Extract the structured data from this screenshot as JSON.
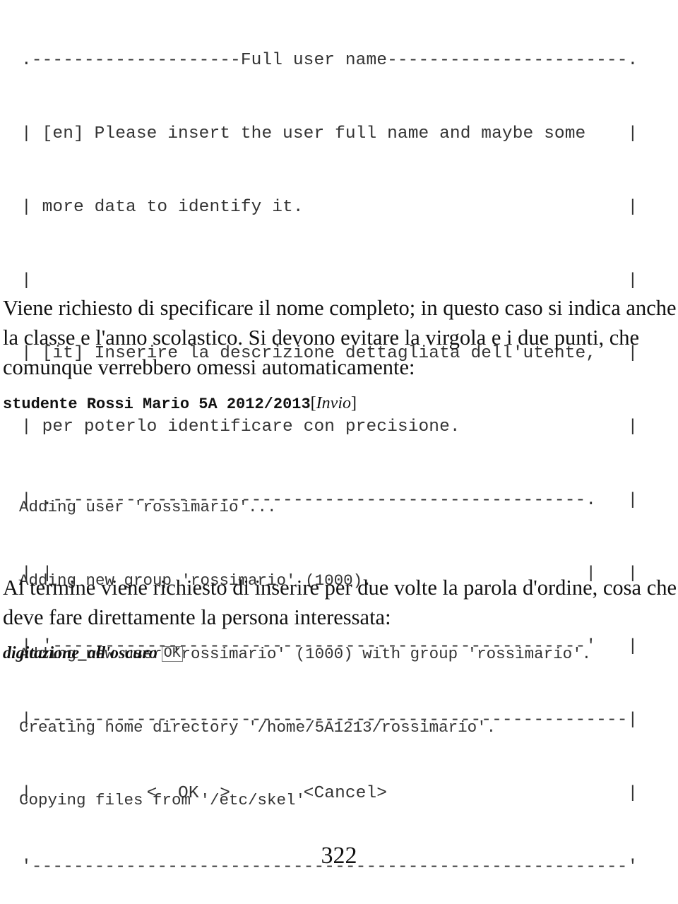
{
  "dialog": {
    "lines": [
      ".--------------------Full user name-----------------------.",
      "| [en] Please insert the user full name and maybe some    |",
      "| more data to identify it.                               |",
      "|                                                         |",
      "| [it] Inserire la descrizione dettagliata dell'utente,   |",
      "| per poterlo identificare con precisione.                |",
      "| .---------------------------------------------------.   |",
      "| |                                                   |   |",
      "| '---------------------------------------------------'   |",
      "|---------------------------------------------------------|",
      "|           <  OK  >       <Cancel>                       |",
      "'---------------------------------------------------------'"
    ],
    "title": "Full user name",
    "ok_button": "<  OK  >",
    "cancel_button": "<Cancel>"
  },
  "paragraph1": "Viene richiesto di specificare il nome completo; in questo caso si indica anche la classe e l'anno scolastico. Si devono evitare la virgola e i due punti, che comunque verrebbero omessi automaticamente:",
  "command": {
    "text": "studente Rossi Mario 5A 2012/2013",
    "key_open": "[",
    "key": "Invio",
    "key_close": "]"
  },
  "output_lines": [
    "Adding user 'rossimario'...",
    "Adding new group 'rossimario' (1000).",
    "Adding new user 'rossimario' (1000) with group 'rossimario'.",
    "Creating home directory '/home/5A1213/rossimario'.",
    "Copying files from '/etc/skel'"
  ],
  "paragraph2": "Al termine viene richiesto di inserire per due volte la parola d'ordine, cosa che deve fare direttamente la persona interessata:",
  "password_prompt": {
    "text": "digitazione_all'oscuro",
    "key": "OK"
  },
  "page_number": "322"
}
